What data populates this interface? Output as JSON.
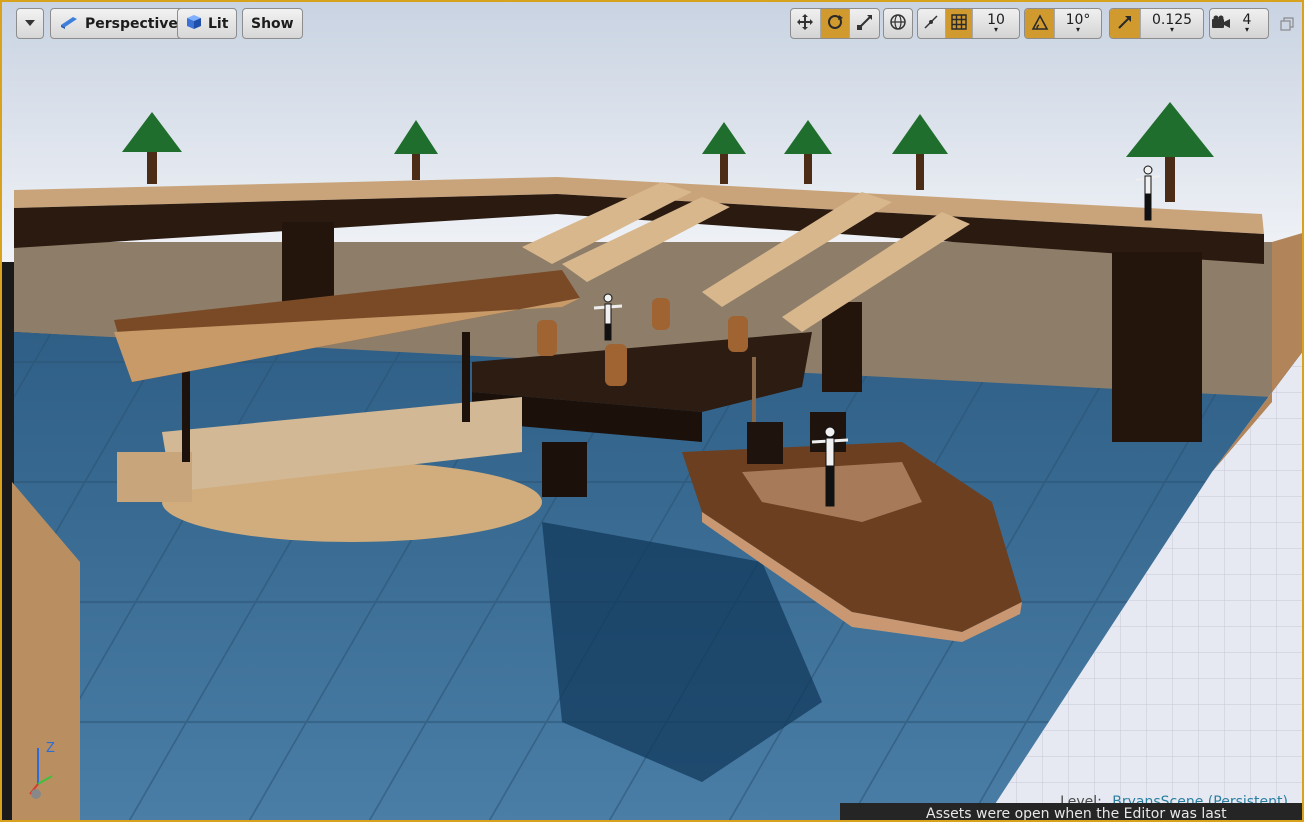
{
  "toolbar": {
    "options_menu_icon": "chevron-down-icon",
    "view_mode": "Perspective",
    "lighting_mode": "Lit",
    "show_label": "Show",
    "grid_snap_value": "10",
    "rotation_snap_value": "10°",
    "scale_snap_value": "0.125",
    "camera_speed_value": "4"
  },
  "status": {
    "level_prefix": "Level:",
    "level_name": "BryansScene (Persistent)",
    "notification": "Assets were open when the Editor was last"
  },
  "gizmo": {
    "z_label": "Z"
  },
  "colors": {
    "accent": "#d19a2e",
    "border": "#d9a21c",
    "water": "#3a6d91",
    "wood": "#6b3f1f"
  }
}
